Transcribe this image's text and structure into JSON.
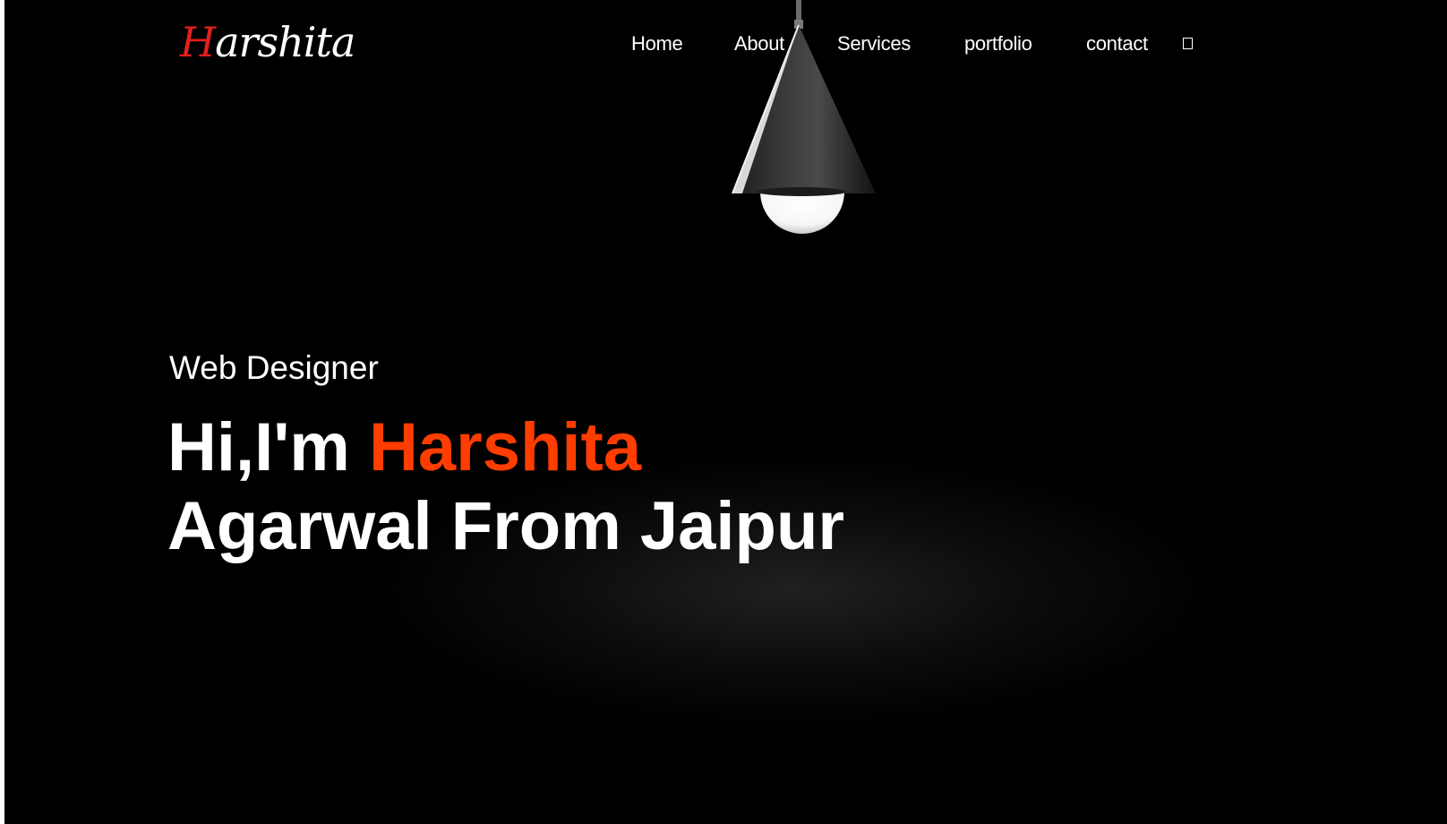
{
  "brand": {
    "logo_first": "H",
    "logo_rest": "arshita"
  },
  "nav": {
    "items": [
      {
        "label": "Home"
      },
      {
        "label": "About"
      },
      {
        "label": "Services"
      },
      {
        "label": "portfolio"
      },
      {
        "label": "contact"
      }
    ],
    "icon": "box-icon"
  },
  "hero": {
    "subtitle": "Web Designer",
    "greeting": "Hi,I'm ",
    "name_highlight": "Harshita",
    "line2": "Agarwal From Jaipur"
  },
  "colors": {
    "background": "#000000",
    "text": "#ffffff",
    "accent": "#ff3d00",
    "logo_accent": "#e0201e"
  }
}
